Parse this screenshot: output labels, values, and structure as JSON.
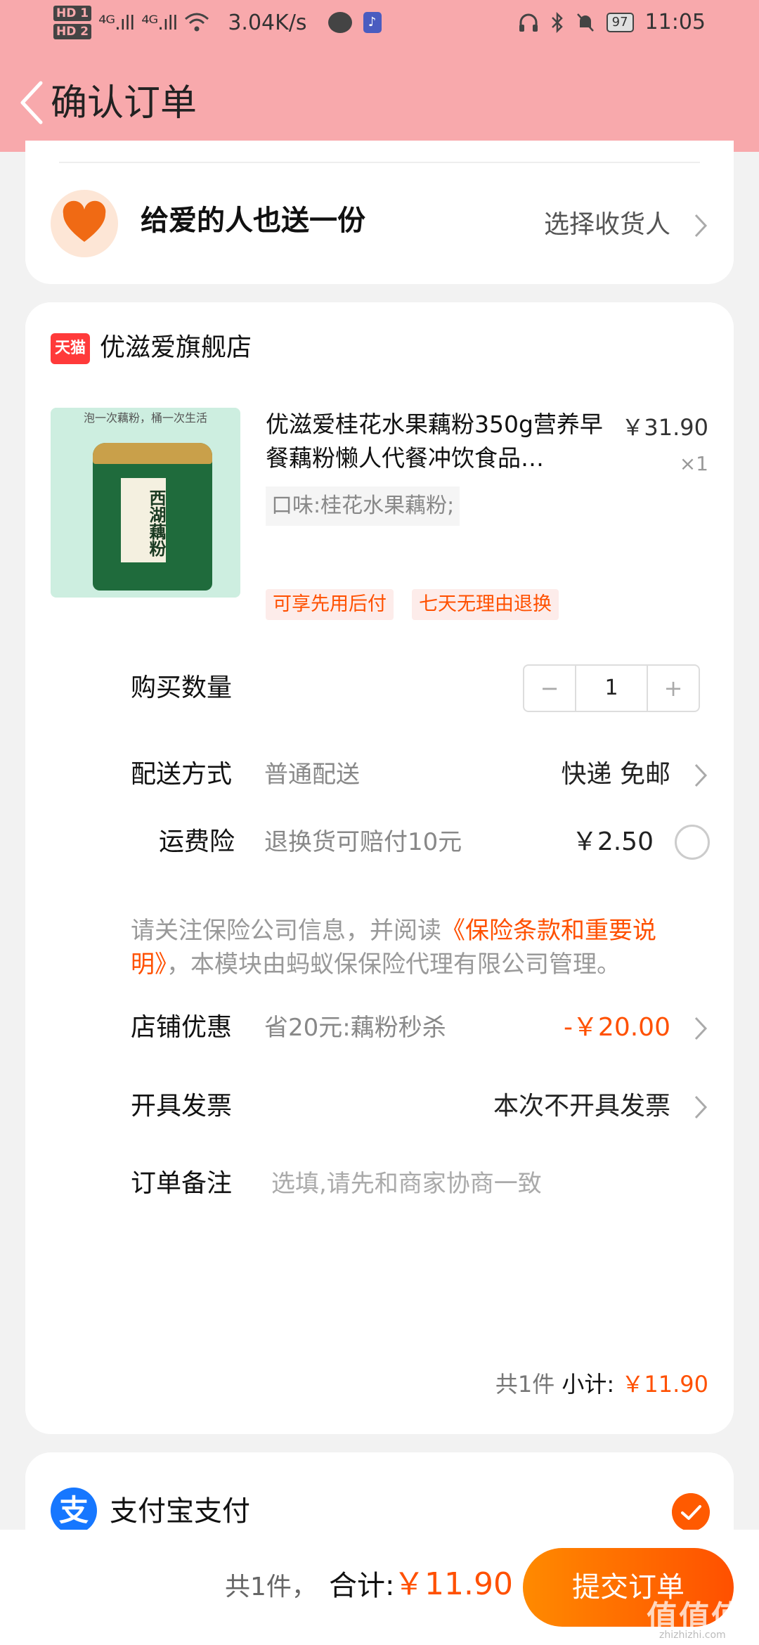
{
  "status_bar": {
    "hd1": "HD 1",
    "hd2": "HD 2",
    "signal1": "⁴ᴳ.ıll",
    "signal2": "⁴ᴳ.ıll",
    "speed": "3.04K/s",
    "battery": "97",
    "time": "11:05"
  },
  "header": {
    "title": "确认订单"
  },
  "gift": {
    "text": "给爱的人也送一份",
    "select": "选择收货人"
  },
  "store": {
    "badge": "天猫",
    "name": "优滋爱旗舰店"
  },
  "product": {
    "thumb_caption": "泡一次藕粉，桶一次生活",
    "thumb_label": "西湖藕粉",
    "title": "优滋爱桂花水果藕粉350g营养早餐藕粉懒人代餐冲饮食品…",
    "price": "￥31.90",
    "qty": "×1",
    "spec": "口味:桂花水果藕粉;",
    "tags": [
      "可享先用后付",
      "七天无理由退换"
    ]
  },
  "rows": {
    "quantity_label": "购买数量",
    "quantity_value": "1",
    "minus": "−",
    "plus": "+",
    "shipping_label": "配送方式",
    "shipping_sub": "普通配送",
    "shipping_value": "快递 免邮",
    "insurance_label": "运费险",
    "insurance_sub": "退换货可赔付10元",
    "insurance_value": "￥2.50",
    "ins_note_pre": "请关注保险公司信息，并阅读",
    "ins_note_link": "《保险条款和重要说明》",
    "ins_note_post": "，本模块由蚂蚁保保险代理有限公司管理。",
    "discount_label": "店铺优惠",
    "discount_sub": "省20元:藕粉秒杀",
    "discount_value": "-￥20.00",
    "invoice_label": "开具发票",
    "invoice_value": "本次不开具发票",
    "note_label": "订单备注",
    "note_placeholder": "选填,请先和商家协商一致"
  },
  "summary": {
    "count": "共1件",
    "subtotal_label": "小计:",
    "subtotal": "￥11.90"
  },
  "payment": {
    "icon": "支",
    "label": "支付宝支付"
  },
  "bottom": {
    "count": "共1件，",
    "total_label": "合计:",
    "total": "￥11.90",
    "submit": "提交订单"
  },
  "watermark": {
    "mark": "值值值",
    "url": "zhizhizhi.com"
  },
  "colors": {
    "header": "#f8a9ac",
    "accent": "#ff5000",
    "alipay": "#1677ff"
  }
}
